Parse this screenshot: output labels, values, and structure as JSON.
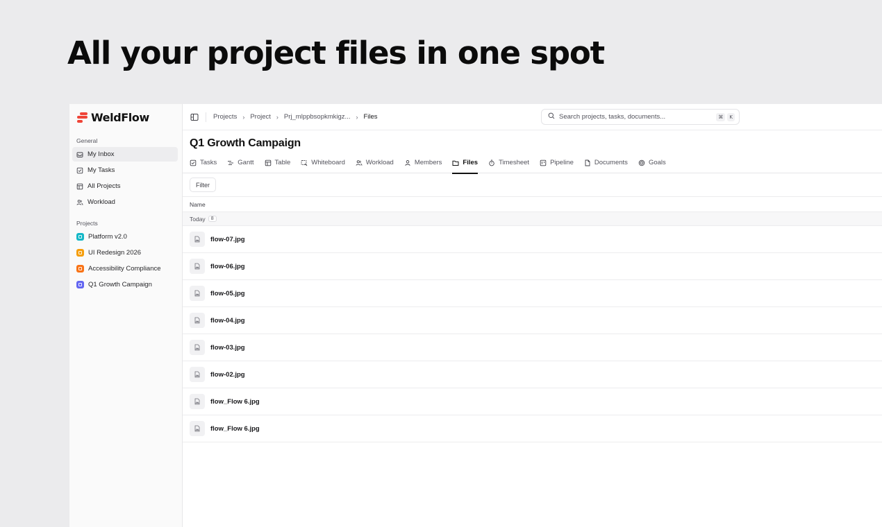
{
  "headline": "All your project files in one spot",
  "brand": {
    "name": "WeldFlow",
    "color": "#ef4437"
  },
  "sidebar": {
    "general_label": "General",
    "general_items": [
      {
        "label": "My Inbox",
        "icon": "inbox-icon",
        "active": true
      },
      {
        "label": "My Tasks",
        "icon": "checkbox-icon"
      },
      {
        "label": "All Projects",
        "icon": "table-icon"
      },
      {
        "label": "Workload",
        "icon": "users-icon"
      }
    ],
    "projects_label": "Projects",
    "projects": [
      {
        "label": "Platform v2.0",
        "color": "#14b8c7"
      },
      {
        "label": "UI Redesign 2026",
        "color": "#f59e0b"
      },
      {
        "label": "Accessibility Compliance",
        "color": "#f97316"
      },
      {
        "label": "Q1 Growth Campaign",
        "color": "#6366f1"
      }
    ]
  },
  "breadcrumb": [
    "Projects",
    "Project",
    "Prj_mlppbsopkmkigz...",
    "Files"
  ],
  "search": {
    "placeholder": "Search projects, tasks, documents...",
    "shortcut_keys": [
      "⌘",
      "K"
    ]
  },
  "page_title": "Q1 Growth Campaign",
  "tabs": [
    {
      "label": "Tasks",
      "icon": "checkbox-icon"
    },
    {
      "label": "Gantt",
      "icon": "gantt-icon"
    },
    {
      "label": "Table",
      "icon": "table-icon"
    },
    {
      "label": "Whiteboard",
      "icon": "whiteboard-icon"
    },
    {
      "label": "Workload",
      "icon": "users-icon"
    },
    {
      "label": "Members",
      "icon": "user-icon"
    },
    {
      "label": "Files",
      "icon": "folder-icon",
      "active": true
    },
    {
      "label": "Timesheet",
      "icon": "timer-icon"
    },
    {
      "label": "Pipeline",
      "icon": "pipeline-icon"
    },
    {
      "label": "Documents",
      "icon": "document-icon"
    },
    {
      "label": "Goals",
      "icon": "target-icon"
    }
  ],
  "filter_label": "Filter",
  "column_header": "Name",
  "group": {
    "label": "Today",
    "count": "8"
  },
  "files": [
    "flow-07.jpg",
    "flow-06.jpg",
    "flow-05.jpg",
    "flow-04.jpg",
    "flow-03.jpg",
    "flow-02.jpg",
    "flow_Flow 6.jpg",
    "flow_Flow 6.jpg"
  ]
}
